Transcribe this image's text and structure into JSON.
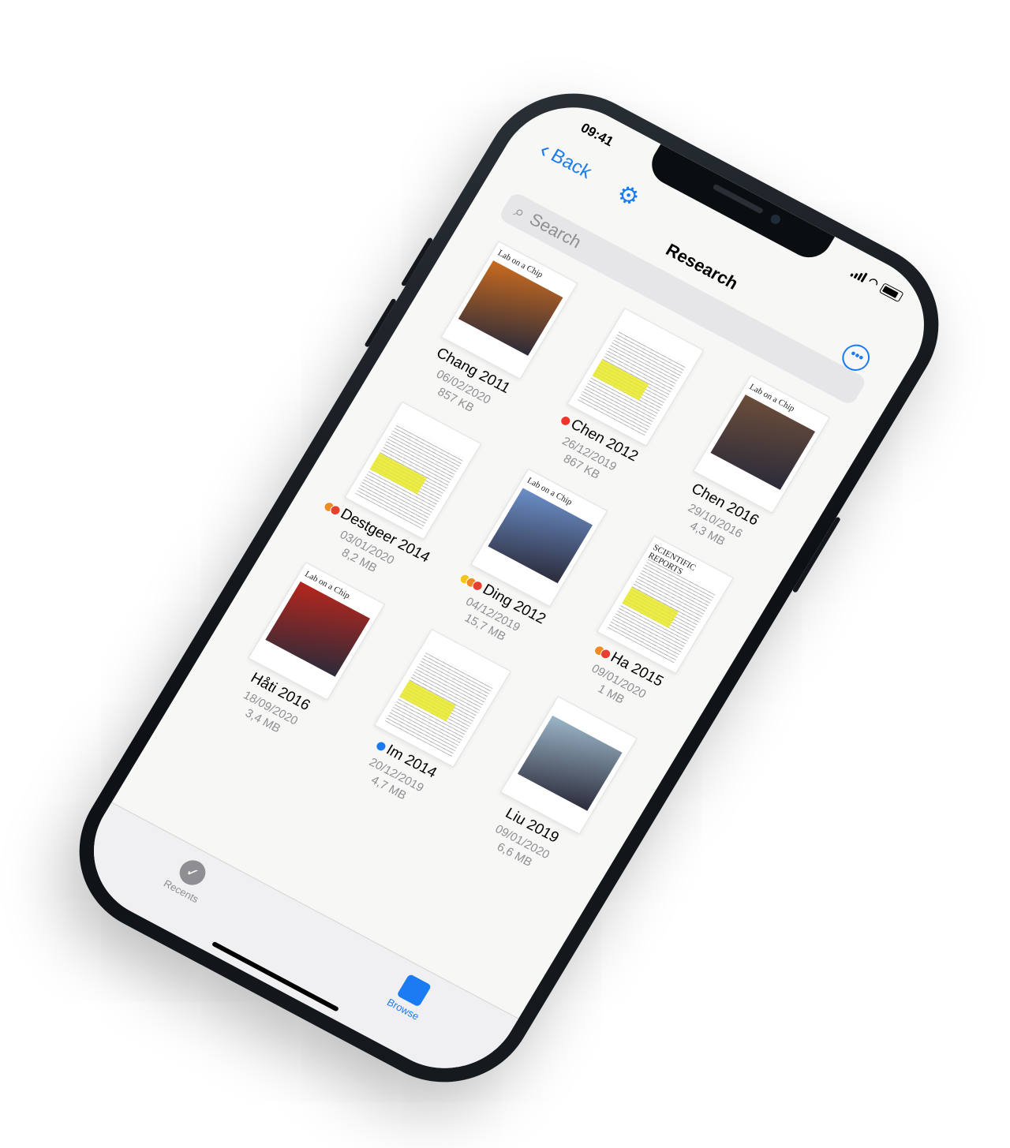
{
  "status": {
    "time": "09:41"
  },
  "nav": {
    "back_label": "Back",
    "title": "Research",
    "search_placeholder": "Search"
  },
  "files": [
    {
      "name": "Chang 2011",
      "date": "06/02/2020",
      "size": "857 KB",
      "tags": [],
      "cover": "Lab on a Chip",
      "kind": "journal"
    },
    {
      "name": "Chen 2012",
      "date": "26/12/2019",
      "size": "867 KB",
      "tags": [
        "#f0352c"
      ],
      "cover": "",
      "kind": "paper"
    },
    {
      "name": "Chen 2016",
      "date": "29/10/2016",
      "size": "4,3 MB",
      "tags": [],
      "cover": "Lab on a Chip",
      "kind": "journal"
    },
    {
      "name": "Destgeer 2014",
      "date": "03/01/2020",
      "size": "8,2 MB",
      "tags": [
        "#f08a24",
        "#e8402f"
      ],
      "cover": "",
      "kind": "paper"
    },
    {
      "name": "Ding 2012",
      "date": "04/12/2019",
      "size": "15,7 MB",
      "tags": [
        "#f5c518",
        "#f08a24",
        "#e8402f"
      ],
      "cover": "Lab on a Chip",
      "kind": "journal"
    },
    {
      "name": "Ha 2015",
      "date": "09/01/2020",
      "size": "1 MB",
      "tags": [
        "#f08a24",
        "#e8402f"
      ],
      "cover": "SCIENTIFIC REPORTS",
      "kind": "paper"
    },
    {
      "name": "Håti 2016",
      "date": "18/09/2020",
      "size": "3,4 MB",
      "tags": [],
      "cover": "Lab on a Chip",
      "kind": "journal"
    },
    {
      "name": "Im 2014",
      "date": "20/12/2019",
      "size": "4,7 MB",
      "tags": [
        "#1a7bf2"
      ],
      "cover": "",
      "kind": "paper"
    },
    {
      "name": "Liu 2019",
      "date": "09/01/2020",
      "size": "6,6 MB",
      "tags": [],
      "cover": "",
      "kind": "journal"
    }
  ],
  "tabbar": {
    "recents": "Recents",
    "browse": "Browse"
  },
  "colors": {
    "accent": "#1a7bf2",
    "highlight": "#e8e928"
  }
}
